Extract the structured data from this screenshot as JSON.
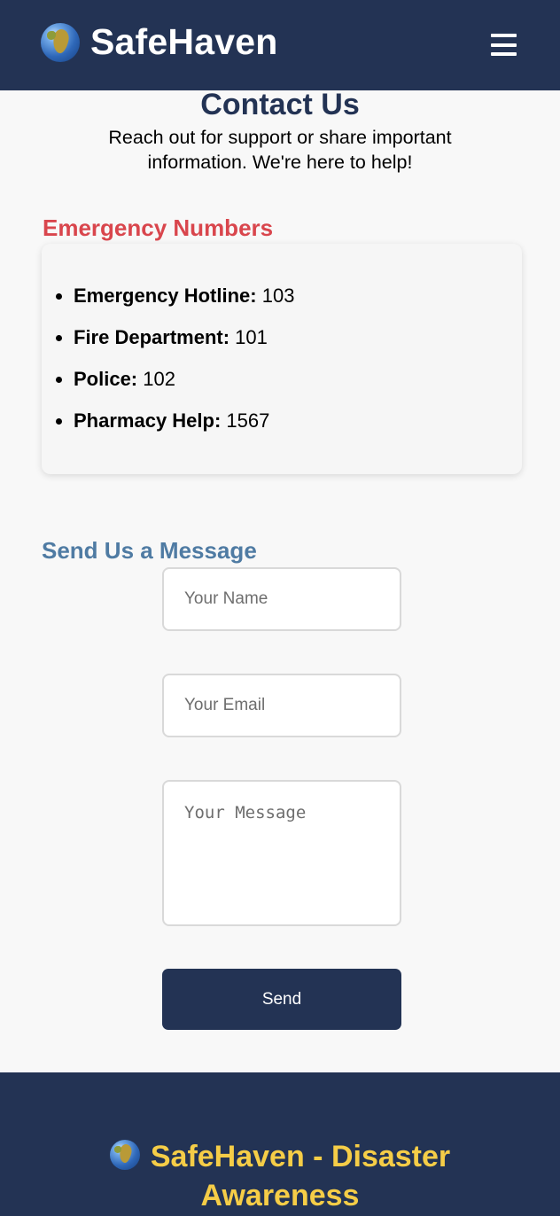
{
  "header": {
    "brand_icon": "globe-icon",
    "brand_name": "SafeHaven",
    "menu_icon": "hamburger-menu-icon"
  },
  "intro": {
    "title": "Contact Us",
    "subtitle": "Reach out for support or share important information. We're here to help!"
  },
  "emergency": {
    "heading": "Emergency Numbers",
    "items": [
      {
        "label": "Emergency Hotline:",
        "number": "103"
      },
      {
        "label": "Fire Department:",
        "number": "101"
      },
      {
        "label": "Police:",
        "number": "102"
      },
      {
        "label": "Pharmacy Help:",
        "number": "1567"
      }
    ]
  },
  "form": {
    "heading": "Send Us a Message",
    "name_placeholder": "Your Name",
    "email_placeholder": "Your Email",
    "message_placeholder": "Your Message",
    "send_label": "Send"
  },
  "footer": {
    "icon": "globe-icon",
    "title": "SafeHaven - Disaster Awareness"
  },
  "colors": {
    "navy": "#233354",
    "emergency_red": "#d9464d",
    "form_blue": "#4f7ba3",
    "footer_yellow": "#f5cd47"
  }
}
